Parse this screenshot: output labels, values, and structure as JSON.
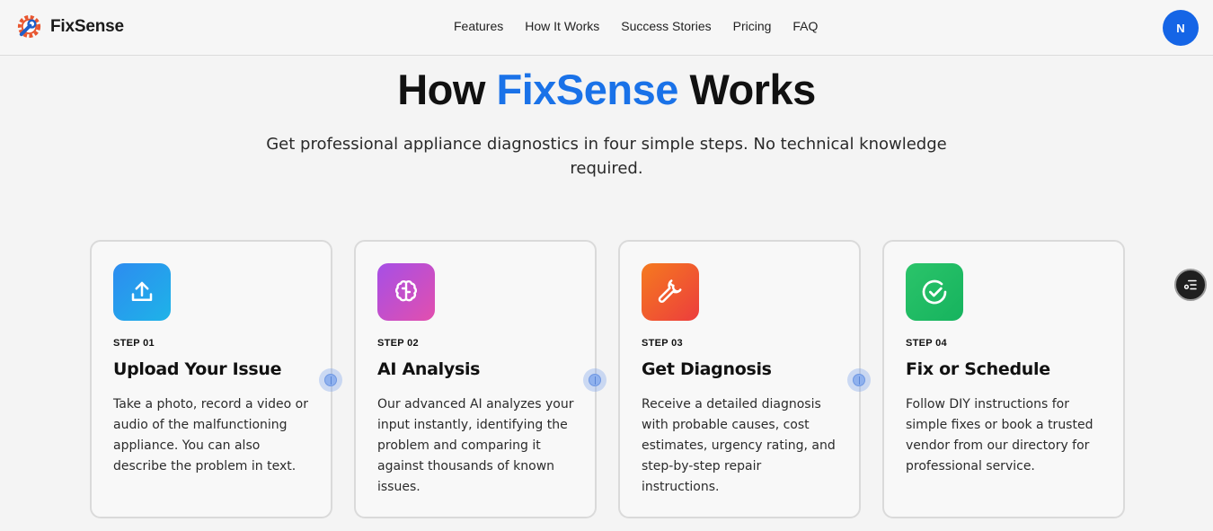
{
  "brand": {
    "name": "FixSense",
    "logo_icon": "gear-wrench-icon"
  },
  "nav": {
    "items": [
      {
        "label": "Features"
      },
      {
        "label": "How It Works"
      },
      {
        "label": "Success Stories"
      },
      {
        "label": "Pricing"
      },
      {
        "label": "FAQ"
      }
    ]
  },
  "user": {
    "avatar_initial": "N",
    "avatar_color": "#1565e6"
  },
  "hero": {
    "title_prefix": "How ",
    "title_accent": "FixSense",
    "title_suffix": " Works",
    "subtitle": "Get professional appliance diagnostics in four simple steps. No technical knowledge required.",
    "accent_color": "#1a72e8"
  },
  "steps": [
    {
      "step": "STEP 01",
      "title": "Upload Your Issue",
      "description": "Take a photo, record a video or audio of the malfunctioning appliance. You can also describe the problem in text.",
      "icon": "upload-icon",
      "colors": [
        "#2d8cf0",
        "#1eb3e8"
      ]
    },
    {
      "step": "STEP 02",
      "title": "AI Analysis",
      "description": "Our advanced AI analyzes your input instantly, identifying the problem and comparing it against thousands of known issues.",
      "icon": "brain-icon",
      "colors": [
        "#a64fe6",
        "#e24fae"
      ]
    },
    {
      "step": "STEP 03",
      "title": "Get Diagnosis",
      "description": "Receive a detailed diagnosis with probable causes, cost estimates, urgency rating, and step-by-step repair instructions.",
      "icon": "wrench-icon",
      "colors": [
        "#f57a1f",
        "#ec3d3d"
      ]
    },
    {
      "step": "STEP 04",
      "title": "Fix or Schedule",
      "description": "Follow DIY instructions for simple fixes or book a trusted vendor from our directory for professional service.",
      "icon": "check-circle-icon",
      "colors": [
        "#2bc46a",
        "#16b35e"
      ]
    }
  ],
  "floating_button": {
    "icon": "settings-list-icon"
  }
}
